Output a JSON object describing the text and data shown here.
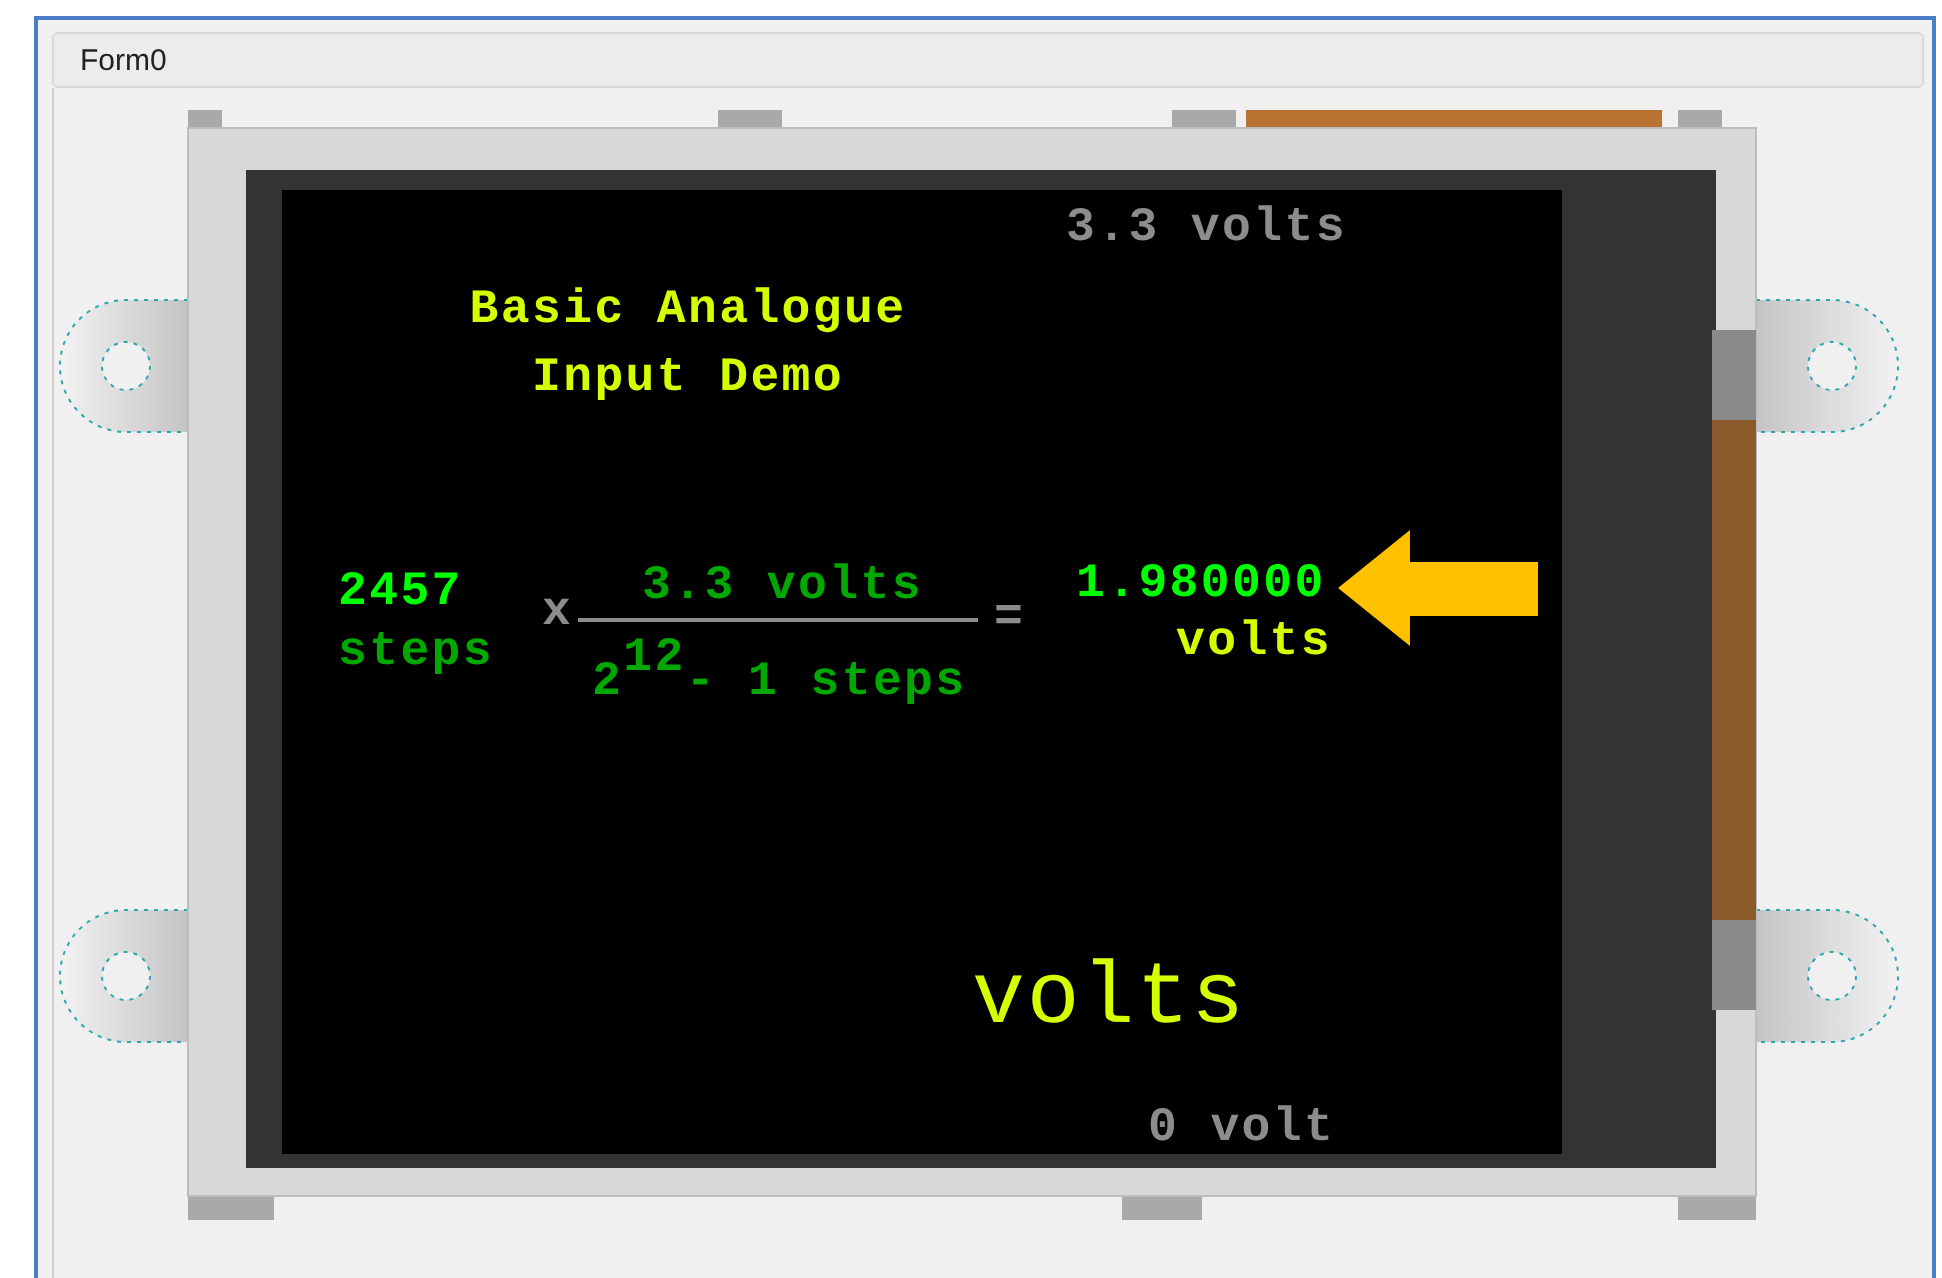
{
  "window": {
    "title": "Form0"
  },
  "display": {
    "top_label": "3.3 volts",
    "title_lines": [
      "Basic Analogue",
      "Input Demo"
    ],
    "reading": {
      "value": "2457",
      "unit": "steps"
    },
    "operator": "x",
    "numerator": "3.3 volts",
    "denominator": "2$^{12}$- 1 steps",
    "equals": "=",
    "result": {
      "value": "1.980000",
      "unit": "volts"
    },
    "big_label": "volts",
    "bottom_label": "0 volt"
  }
}
